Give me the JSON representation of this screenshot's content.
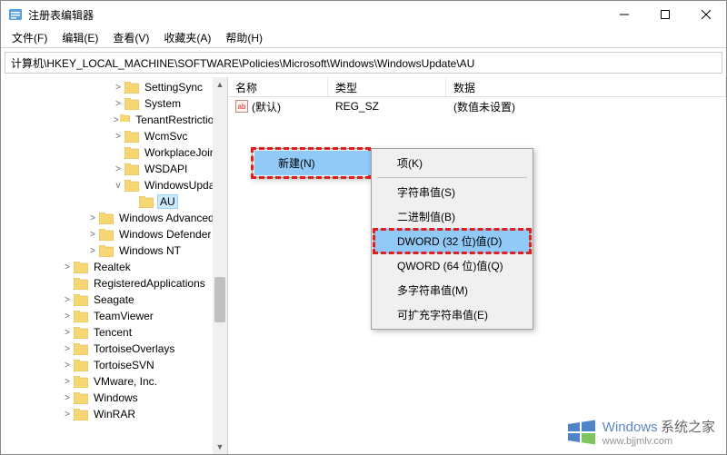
{
  "titlebar": {
    "title": "注册表编辑器"
  },
  "menus": {
    "file": "文件(F)",
    "edit": "编辑(E)",
    "view": "查看(V)",
    "favorites": "收藏夹(A)",
    "help": "帮助(H)"
  },
  "address": "计算机\\HKEY_LOCAL_MACHINE\\SOFTWARE\\Policies\\Microsoft\\Windows\\WindowsUpdate\\AU",
  "tree": {
    "lvl3": [
      {
        "label": "SettingSync",
        "exp": ">"
      },
      {
        "label": "System",
        "exp": ">"
      },
      {
        "label": "TenantRestrictions",
        "exp": ">"
      },
      {
        "label": "WcmSvc",
        "exp": ">"
      },
      {
        "label": "WorkplaceJoin",
        "exp": ""
      },
      {
        "label": "WSDAPI",
        "exp": ">"
      },
      {
        "label": "WindowsUpdate",
        "exp": "v",
        "child": {
          "label": "AU",
          "selected": true
        }
      }
    ],
    "lvl2": [
      {
        "label": "Windows Advanced"
      },
      {
        "label": "Windows Defender"
      },
      {
        "label": "Windows NT"
      }
    ],
    "lvl1": [
      {
        "label": "Realtek",
        "exp": ">"
      },
      {
        "label": "RegisteredApplications",
        "exp": ""
      },
      {
        "label": "Seagate",
        "exp": ">"
      },
      {
        "label": "TeamViewer",
        "exp": ">"
      },
      {
        "label": "Tencent",
        "exp": ">"
      },
      {
        "label": "TortoiseOverlays",
        "exp": ">"
      },
      {
        "label": "TortoiseSVN",
        "exp": ">"
      },
      {
        "label": "VMware, Inc.",
        "exp": ">"
      },
      {
        "label": "Windows",
        "exp": ">"
      },
      {
        "label": "WinRAR",
        "exp": ">"
      }
    ]
  },
  "list": {
    "headers": {
      "name": "名称",
      "type": "类型",
      "data": "数据"
    },
    "rows": [
      {
        "name": "(默认)",
        "icon": "ab",
        "type": "REG_SZ",
        "data": "(数值未设置)"
      }
    ]
  },
  "context_menu": {
    "new": "新建(N)",
    "submenu": [
      {
        "label": "项(K)"
      },
      {
        "label": "字符串值(S)"
      },
      {
        "label": "二进制值(B)"
      },
      {
        "label": "DWORD (32 位)值(D)",
        "highlight": true
      },
      {
        "label": "QWORD (64 位)值(Q)"
      },
      {
        "label": "多字符串值(M)"
      },
      {
        "label": "可扩充字符串值(E)"
      }
    ]
  },
  "watermark": {
    "brand": "Windows",
    "suffix": "系统之家",
    "url": "www.bjjmlv.com"
  }
}
